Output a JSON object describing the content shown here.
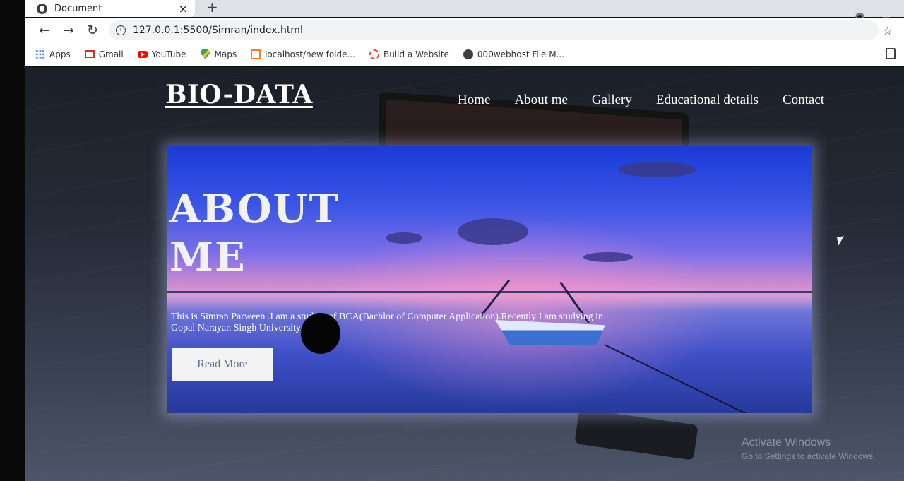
{
  "browser": {
    "tab_title": "Document",
    "tab_close": "×",
    "new_tab": "+",
    "url": "127.0.0.1:5500/Simran/index.html",
    "bookmarks": [
      {
        "label": "Apps",
        "icon": "apps-grid-icon"
      },
      {
        "label": "Gmail",
        "icon": "gmail-icon"
      },
      {
        "label": "YouTube",
        "icon": "youtube-icon"
      },
      {
        "label": "Maps",
        "icon": "maps-icon"
      },
      {
        "label": "localhost/new folde...",
        "icon": "xampp-icon"
      },
      {
        "label": "Build a Website",
        "icon": "build-icon"
      },
      {
        "label": "000webhost File M...",
        "icon": "globe-icon"
      }
    ]
  },
  "site": {
    "brand": "BIO-DATA",
    "nav": [
      "Home",
      "About me",
      "Gallery",
      "Educational details",
      "Contact"
    ],
    "hero": {
      "title_line1": "ABOUT",
      "title_line2": "ME",
      "text": "This is Simran Parween .I am a student of BCA(Bachlor of Computer Application).Recently I am studying in Gopal Narayan Singh University",
      "button": "Read More"
    }
  },
  "watermark": {
    "line1": "Activate Windows",
    "line2": "Go to Settings to activate Windows."
  },
  "colors": {
    "chrome": "#dee1e6",
    "omnibox": "#f1f3f4",
    "page_bg": "#1b1f27",
    "hero_sky": "#1a3bd8",
    "hero_glow": "#d08bd0"
  }
}
